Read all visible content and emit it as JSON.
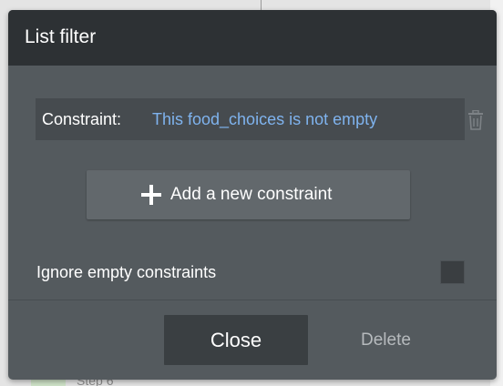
{
  "background": {
    "step_label": "Step 6"
  },
  "dialog": {
    "title": "List filter",
    "constraint": {
      "label": "Constraint:",
      "expression": "This food_choices is not empty"
    },
    "add_constraint_label": "Add a new constraint",
    "ignore_empty_label": "Ignore empty constraints",
    "ignore_empty_checked": false,
    "close_label": "Close",
    "delete_label": "Delete"
  },
  "icons": {
    "trash": "trash-icon",
    "plus": "plus-icon"
  },
  "colors": {
    "header_bg": "#2d3134",
    "panel_bg": "#545a5e",
    "expression_text": "#7fb3ee",
    "delete_text": "#b6babd"
  }
}
